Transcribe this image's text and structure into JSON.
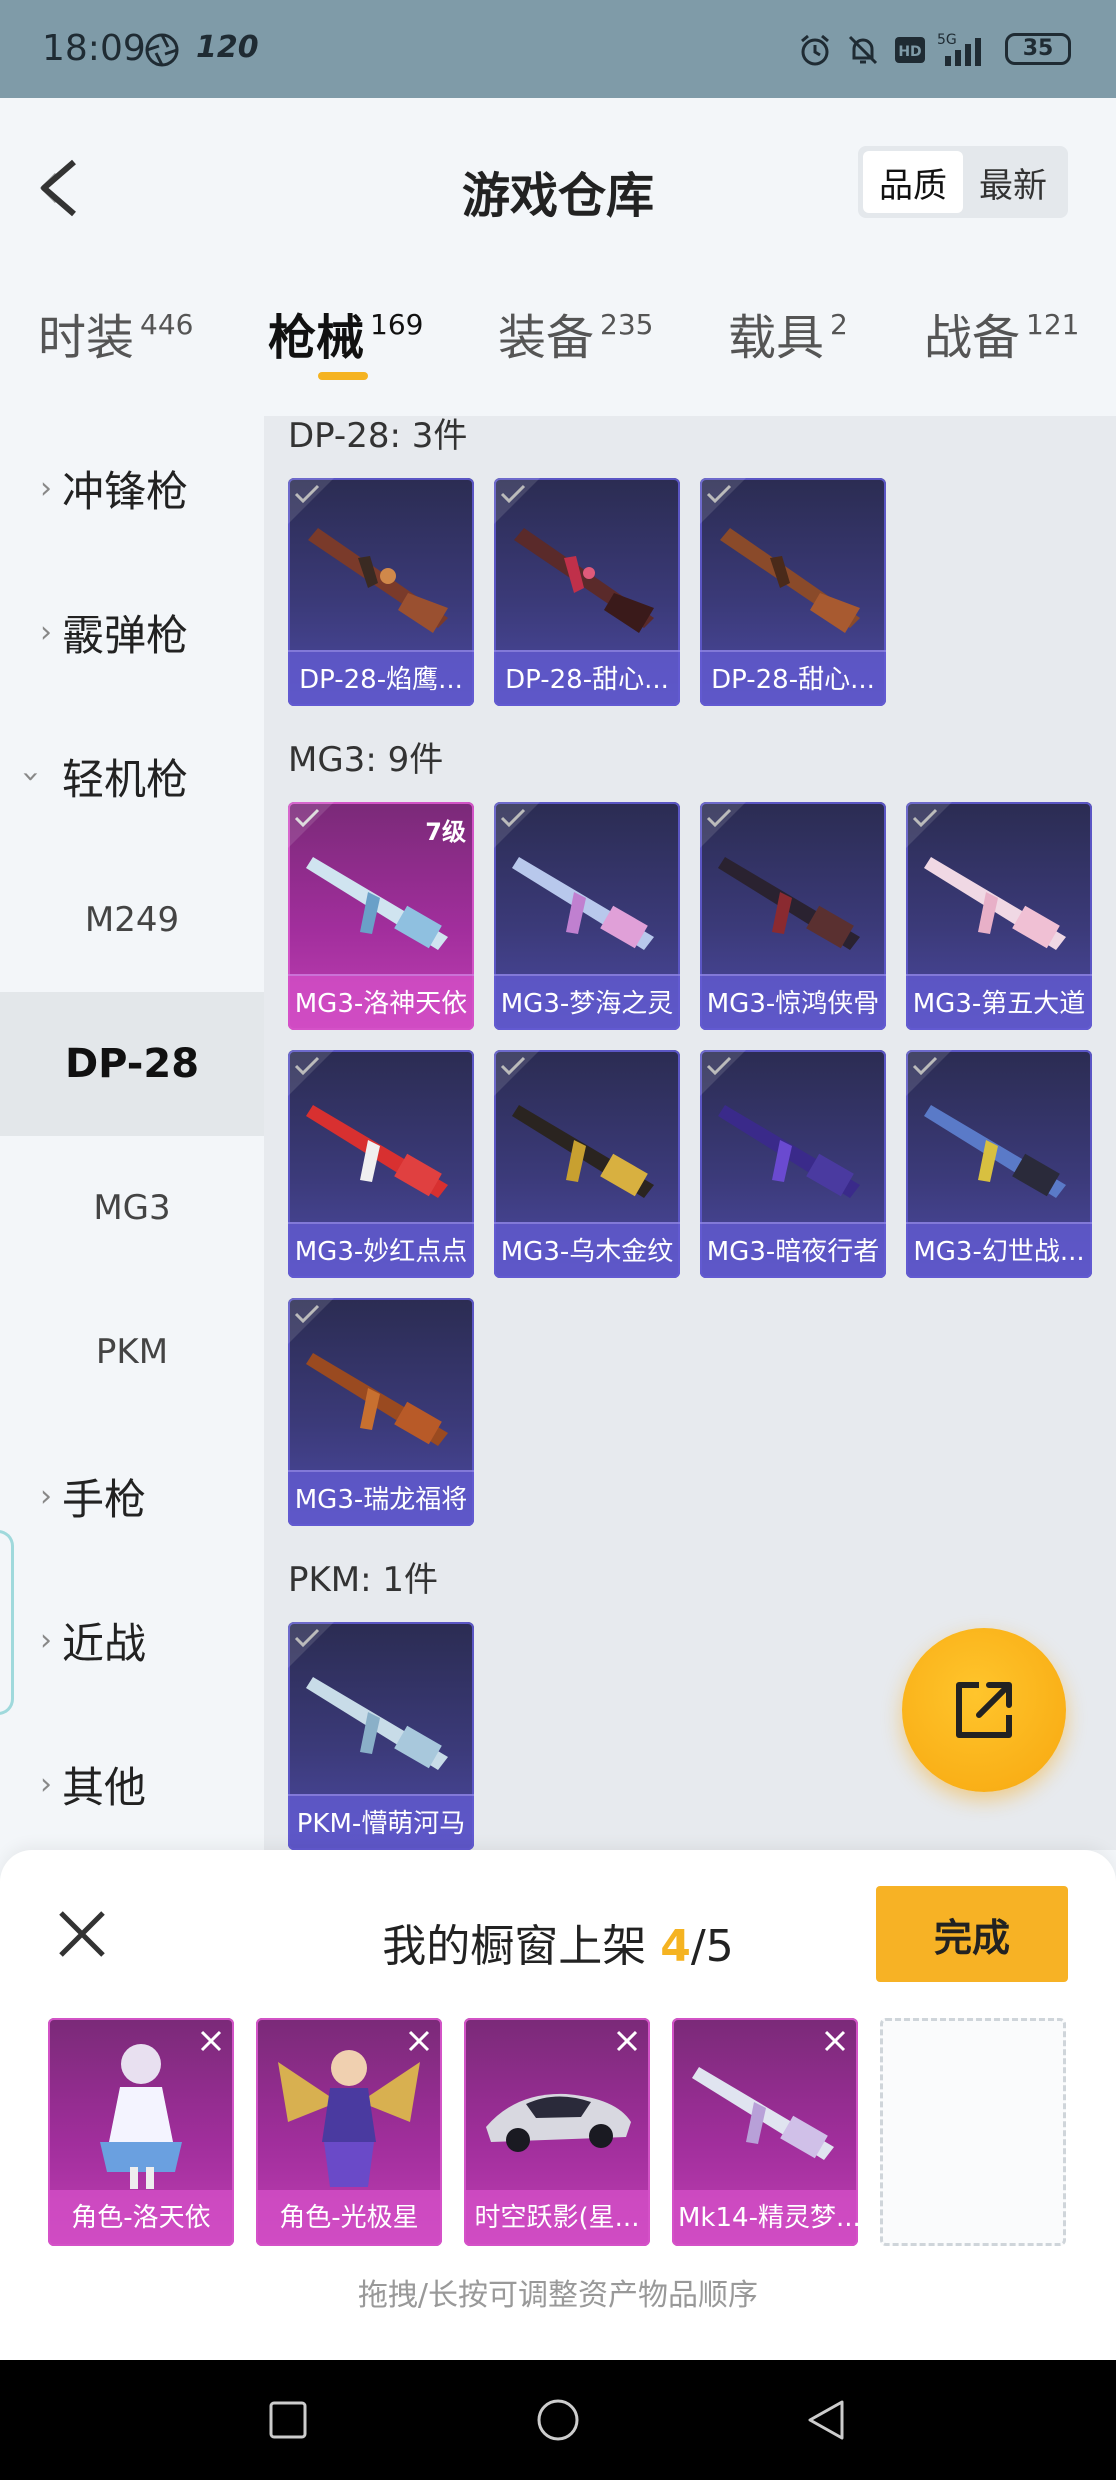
{
  "status_bar": {
    "time": "18:09",
    "refresh": "120",
    "battery": "35"
  },
  "header": {
    "title": "游戏仓库",
    "sort_options": [
      {
        "label": "品质",
        "active": true
      },
      {
        "label": "最新",
        "active": false
      }
    ]
  },
  "tabs": [
    {
      "label": "时装",
      "count": "446"
    },
    {
      "label": "枪械",
      "count": "169",
      "active": true
    },
    {
      "label": "装备",
      "count": "235"
    },
    {
      "label": "载具",
      "count": "2"
    },
    {
      "label": "战备",
      "count": "121"
    }
  ],
  "sidebar": {
    "items": [
      {
        "label": "冲锋枪",
        "type": "group"
      },
      {
        "label": "霰弹枪",
        "type": "group"
      },
      {
        "label": "轻机枪",
        "type": "group",
        "expanded": true
      },
      {
        "label": "M249",
        "type": "sub"
      },
      {
        "label": "DP-28",
        "type": "sub",
        "selected": true
      },
      {
        "label": "MG3",
        "type": "sub"
      },
      {
        "label": "PKM",
        "type": "sub"
      },
      {
        "label": "手枪",
        "type": "group"
      },
      {
        "label": "近战",
        "type": "group"
      },
      {
        "label": "其他",
        "type": "group"
      }
    ]
  },
  "sections": [
    {
      "title": "DP-28: 3件",
      "items": [
        {
          "name": "DP-28-焰鹰...",
          "color": "purple"
        },
        {
          "name": "DP-28-甜心...",
          "color": "purple"
        },
        {
          "name": "DP-28-甜心...",
          "color": "purple"
        }
      ]
    },
    {
      "title": "MG3: 9件",
      "items": [
        {
          "name": "MG3-洛神天依",
          "color": "pink",
          "level": "7级"
        },
        {
          "name": "MG3-梦海之灵",
          "color": "purple"
        },
        {
          "name": "MG3-惊鸿侠骨",
          "color": "purple"
        },
        {
          "name": "MG3-第五大道",
          "color": "purple"
        },
        {
          "name": "MG3-妙红点点",
          "color": "purple"
        },
        {
          "name": "MG3-乌木金纹",
          "color": "purple"
        },
        {
          "name": "MG3-暗夜行者",
          "color": "purple"
        },
        {
          "name": "MG3-幻世战...",
          "color": "purple"
        },
        {
          "name": "MG3-瑞龙福将",
          "color": "purple"
        }
      ]
    },
    {
      "title": "PKM: 1件",
      "items": [
        {
          "name": "PKM-懵萌河马",
          "color": "purple"
        }
      ]
    }
  ],
  "showcase": {
    "title_prefix": "我的橱窗上架",
    "current": "4",
    "total": "/5",
    "done_label": "完成",
    "slots": [
      {
        "name": "角色-洛天依"
      },
      {
        "name": "角色-光极星"
      },
      {
        "name": "时空跃影(星..."
      },
      {
        "name": "Mk14-精灵梦..."
      },
      {
        "name": ""
      }
    ],
    "hint": "拖拽/长按可调整资产物品顺序"
  },
  "colors": {
    "accent": "#f5b321",
    "card_purple": "#3b3a79",
    "card_pink": "#a12e9c"
  },
  "icons": [
    "back-arrow-icon",
    "share-export-icon",
    "close-icon",
    "check-mark-icon",
    "nav-recent-icon",
    "nav-home-icon",
    "nav-back-icon"
  ]
}
